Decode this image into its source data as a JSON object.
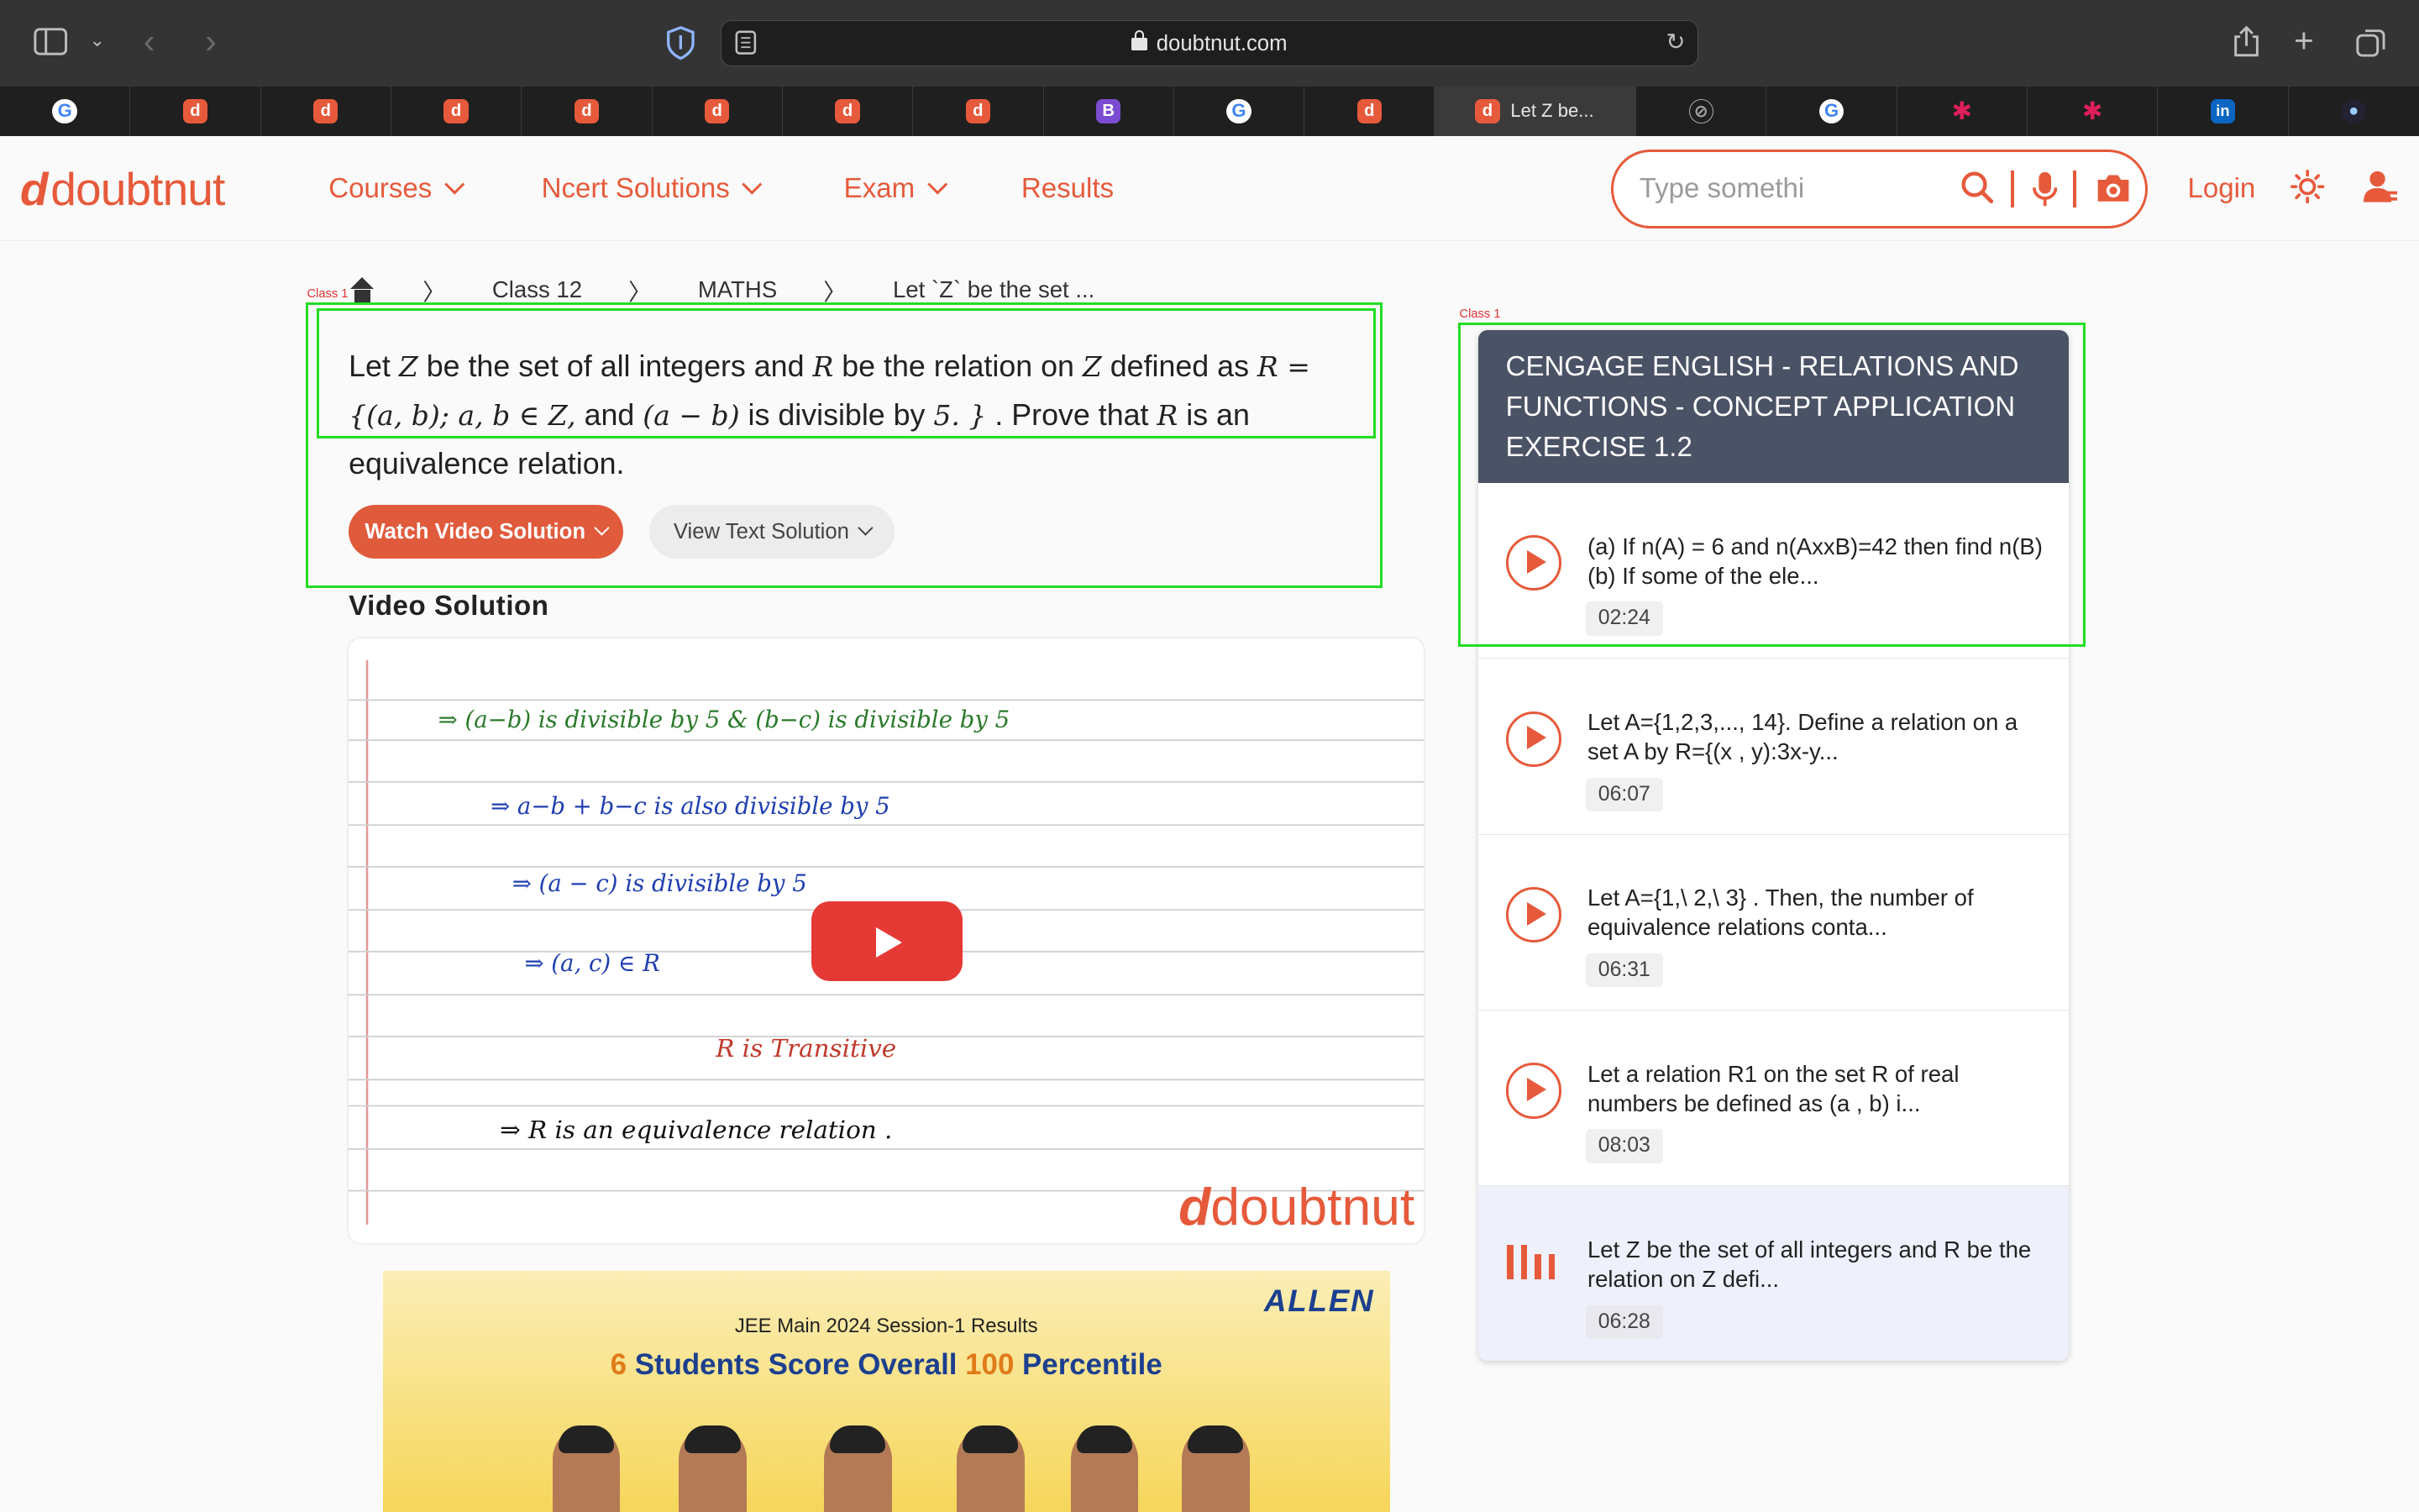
{
  "browser": {
    "url": "doubtnut.com",
    "active_tab_title": "Let Z be..."
  },
  "site": {
    "logo_text": "doubtnut",
    "nav": [
      "Courses",
      "Ncert Solutions",
      "Exam",
      "Results"
    ],
    "search_placeholder": "Type somethi",
    "login_label": "Login"
  },
  "breadcrumb": [
    "Class 12",
    "MATHS",
    "Let `Z` be the set ..."
  ],
  "debug_labels": {
    "left": "Class 1",
    "right": "Class 1"
  },
  "question": {
    "p1": "Let ",
    "p2": "Z",
    "p3": " be the set of all integers and ",
    "p4": "R",
    "p5": " be the relation on ",
    "p6": "Z",
    "p7": " defined as ",
    "p8": "R = {(a, b); a,  b  ∈ Z,",
    "p9": " and ",
    "p10": "(a − b)",
    "p11": " is divisible by ",
    "p12": "5. }",
    "p13": " . Prove that ",
    "p14": "R",
    "p15": " is an equivalence relation."
  },
  "buttons": {
    "watch": "Watch Video Solution",
    "text": "View Text Solution"
  },
  "video_solution_title": "Video Solution",
  "video": {
    "watermark": "doubtnut",
    "lines": [
      "⇒  (a−b)  is  divisible by 5   &   (b−c)  is  divisible  by  5",
      "⇒   a−b + b−c   is   also   divisible   by  5",
      "⇒   (a − c)   is   divisible  by  5",
      "⇒   (a, c)   ∈  R",
      "R is   Transitive",
      "⇒   R   is   an   equivalence   relation ."
    ]
  },
  "ad": {
    "brand": "ALLEN",
    "line1": "JEE Main 2024 Session-1 Results",
    "line2_a": "6",
    "line2_b": " Students Score Overall ",
    "line2_c": "100",
    "line2_d": " Percentile"
  },
  "panel": {
    "header": "CENGAGE ENGLISH  -  RELATIONS AND FUNCTIONS  -  CONCEPT APPLICATION EXERCISE 1.2",
    "items": [
      {
        "text": "(a) If n(A) = 6 and n(AxxB)=42 then find n(B) (b) If some of the ele...",
        "duration": "02:24"
      },
      {
        "text": "Let A={1,2,3,..., 14}. Define a relation on a set A by R={(x , y):3x-y...",
        "duration": "06:07"
      },
      {
        "text": "Let A={1,\\ 2,\\ 3} . Then, the number of equivalence relations conta...",
        "duration": "06:31"
      },
      {
        "text": "Let a relation R1 on the set R of real numbers be defined as (a , b) i...",
        "duration": "08:03"
      },
      {
        "text": "Let Z be the set of all integers and R be the relation on Z defi...",
        "duration": "06:28"
      }
    ]
  },
  "colors": {
    "brand": "#e65a3b",
    "panel_header": "#4a5265",
    "debug_box": "#22dd22"
  }
}
